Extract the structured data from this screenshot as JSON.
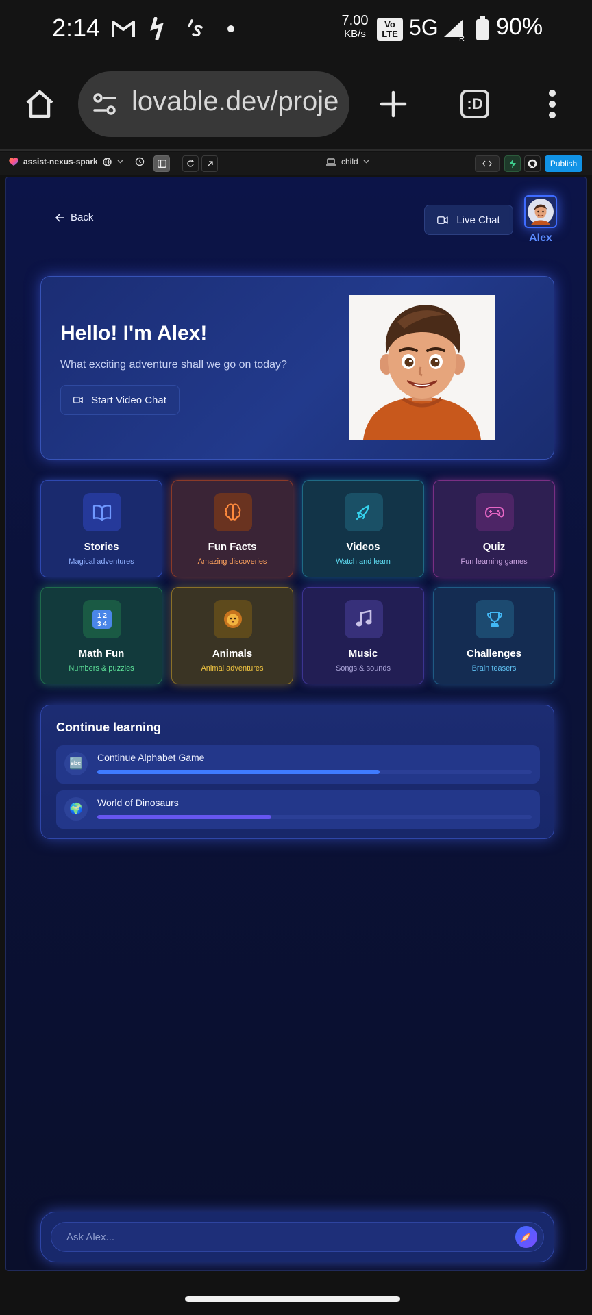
{
  "status_bar": {
    "time": "2:14",
    "speed_value": "7.00",
    "speed_unit": "KB/s",
    "volte_top": "Vo",
    "volte_bottom": "LTE",
    "network": "5G",
    "roaming": "R",
    "battery": "90%"
  },
  "browser": {
    "url": "lovable.dev/proje",
    "tabs_label": ":D"
  },
  "editor_bar": {
    "project_name": "assist-nexus-spark",
    "device_label": "child",
    "publish_label": "Publish"
  },
  "app": {
    "back_label": "Back",
    "live_chat_label": "Live Chat",
    "avatar_name": "Alex",
    "hero": {
      "title": "Hello! I'm Alex!",
      "subtitle": "What exciting adventure shall we go on today?",
      "button_label": "Start Video Chat"
    },
    "tiles": [
      {
        "title": "Stories",
        "subtitle": "Magical adventures",
        "icon": "book-open-icon",
        "accent": "#5b8bff"
      },
      {
        "title": "Fun Facts",
        "subtitle": "Amazing discoveries",
        "icon": "brain-icon",
        "accent": "#ff7a2e"
      },
      {
        "title": "Videos",
        "subtitle": "Watch and learn",
        "icon": "rocket-icon",
        "accent": "#2ec9e6"
      },
      {
        "title": "Quiz",
        "subtitle": "Fun learning games",
        "icon": "gamepad-icon",
        "accent": "#e05fb8"
      },
      {
        "title": "Math Fun",
        "subtitle": "Numbers & puzzles",
        "icon": "numbers-emoji-icon",
        "accent": "#3ddc84"
      },
      {
        "title": "Animals",
        "subtitle": "Animal adventures",
        "icon": "lion-emoji-icon",
        "accent": "#f2c12e"
      },
      {
        "title": "Music",
        "subtitle": "Songs & sounds",
        "icon": "music-note-emoji-icon",
        "accent": "#9b7bff"
      },
      {
        "title": "Challenges",
        "subtitle": "Brain teasers",
        "icon": "trophy-icon",
        "accent": "#38bdf8"
      }
    ],
    "continue_learning": {
      "title": "Continue learning",
      "items": [
        {
          "label": "Continue Alphabet Game",
          "icon": "abc-emoji-icon",
          "glyph": "🔤",
          "progress": 0.65,
          "color": "#3f7bff"
        },
        {
          "label": "World of Dinosaurs",
          "icon": "globe-emoji-icon",
          "glyph": "🌍",
          "progress": 0.4,
          "color": "#6656f0"
        }
      ]
    },
    "ask": {
      "placeholder": "Ask Alex..."
    }
  }
}
